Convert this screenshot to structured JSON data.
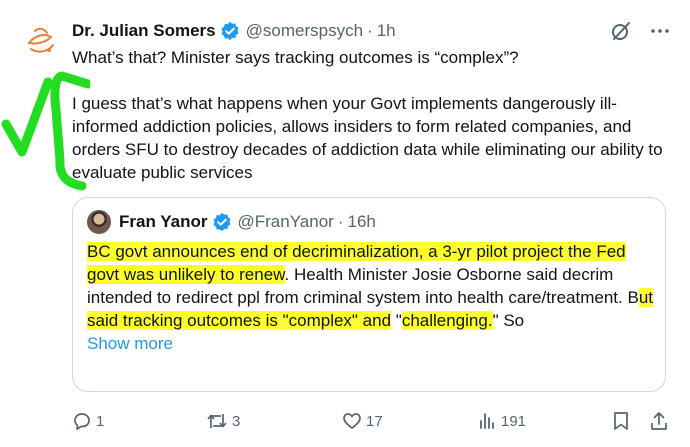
{
  "author": {
    "name": "Dr. Julian Somers",
    "handle": "@somerspsych",
    "separator": "·",
    "time": "1h"
  },
  "tweet": {
    "line1": "What’s that? Minister says tracking outcomes is “complex”?",
    "body": "I guess that’s what happens when your Govt implements dangerously ill-informed addiction policies, allows insiders to form related companies, and orders SFU to destroy decades of addiction data while eliminating our ability to evaluate public services"
  },
  "quote": {
    "name": "Fran Yanor",
    "handle": "@FranYanor",
    "separator": "·",
    "time": "16h",
    "hl1": "BC govt announces end of decriminalization, a 3-yr pilot project the Fed govt was unlikely to renew",
    "plain1": ". Health Minister Josie Osborne said decrim intended to redirect ppl from criminal system into health care/treatment. B",
    "hl2": "ut said tracking outcomes is \"complex\" and",
    "plain2": " \"",
    "hl3": "challenging.",
    "plain3": "\" So",
    "show_more": "Show more"
  },
  "actions": {
    "replies": "1",
    "reposts": "3",
    "likes": "17",
    "views": "191"
  },
  "colors": {
    "accent": "#1d9bf0",
    "highlight": "#ffff2a",
    "annotation": "#22dd22",
    "muted": "#536471"
  },
  "icons": [
    "logo-avatar-icon",
    "verified-badge-icon",
    "grok-icon",
    "more-icon",
    "reply-icon",
    "repost-icon",
    "like-icon",
    "views-icon",
    "bookmark-icon",
    "share-icon"
  ]
}
